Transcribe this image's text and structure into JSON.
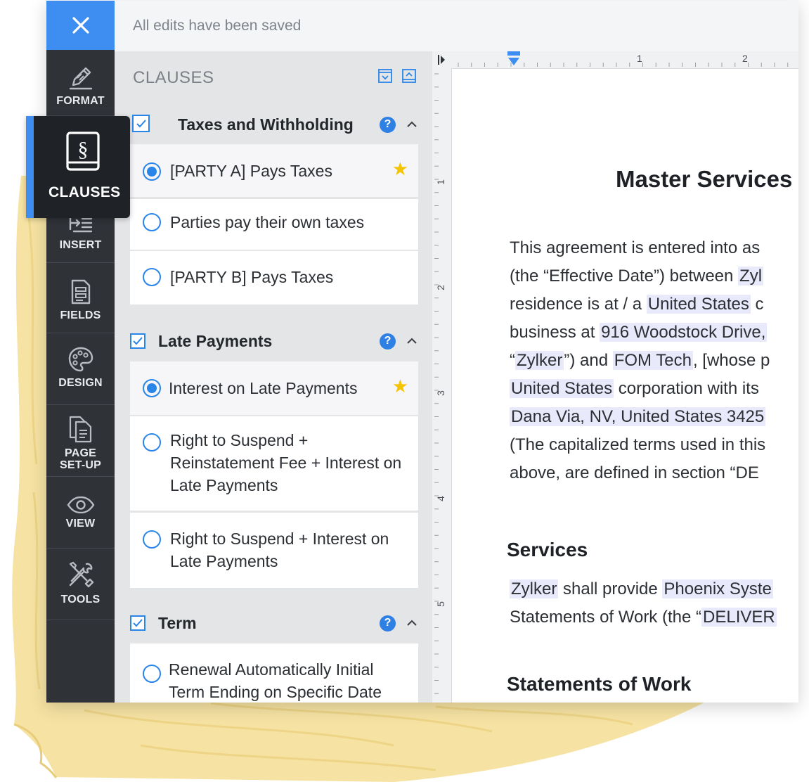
{
  "topbar": {
    "status": "All edits have been saved"
  },
  "icons": {
    "close": "close-icon"
  },
  "nav": [
    {
      "id": "format",
      "label": "FORMAT",
      "icon": "pen-icon"
    },
    {
      "id": "clauses",
      "label": "CLAUSES",
      "icon": "section-book-icon",
      "active": true
    },
    {
      "id": "insert",
      "label": "INSERT",
      "icon": "insert-icon"
    },
    {
      "id": "fields",
      "label": "FIELDS",
      "icon": "form-fields-icon"
    },
    {
      "id": "design",
      "label": "DESIGN",
      "icon": "palette-icon"
    },
    {
      "id": "page-setup",
      "label": "PAGE SET-UP",
      "icon": "pages-icon"
    },
    {
      "id": "view",
      "label": "VIEW",
      "icon": "eye-icon"
    },
    {
      "id": "tools",
      "label": "TOOLS",
      "icon": "wrench-screwdriver-icon"
    }
  ],
  "clauses": {
    "title": "CLAUSES",
    "groups": [
      {
        "title": "Taxes and Withholding",
        "checked": true,
        "options": [
          {
            "text": "[PARTY A] Pays Taxes",
            "selected": true,
            "starred": true
          },
          {
            "text": "Parties pay their own taxes",
            "selected": false
          },
          {
            "text": "[PARTY B] Pays Taxes",
            "selected": false
          }
        ]
      },
      {
        "title": "Late Payments",
        "checked": true,
        "options": [
          {
            "text": "Interest on Late Payments",
            "selected": true,
            "starred": true
          },
          {
            "text": "Right to Suspend + Reinstatement Fee + Interest on Late Payments",
            "selected": false
          },
          {
            "text": "Right to Suspend + Interest on Late Payments",
            "selected": false
          }
        ]
      },
      {
        "title": "Term",
        "checked": true,
        "options": [
          {
            "text": "Renewal Automatically Initial Term Ending on Specific Date",
            "selected": false
          }
        ]
      }
    ]
  },
  "ruler": {
    "top": [
      "1",
      "2"
    ],
    "left": [
      "1",
      "2",
      "3",
      "4",
      "5"
    ]
  },
  "document": {
    "title": "Master Services",
    "intro": [
      [
        "This agreement is entered into as"
      ],
      [
        "(the “Effective Date”) between ",
        {
          "hl": "Zyl"
        }
      ],
      [
        "residence is at / a ",
        {
          "hl": "United States"
        },
        " c"
      ],
      [
        "business at ",
        {
          "hl": "916 Woodstock Drive,"
        }
      ],
      [
        "“",
        {
          "hl": "Zylker"
        },
        "”) and ",
        {
          "hl": "FOM Tech"
        },
        ", [whose p"
      ],
      [
        {
          "hl": "United States"
        },
        " corporation with its"
      ],
      [
        {
          "hl": "Dana Via, NV, United States 3425"
        }
      ],
      [
        "(The capitalized terms used in this"
      ],
      [
        "above, are defined in section “DE"
      ]
    ],
    "services_heading": "Services",
    "services": [
      [
        {
          "hl": "Zylker"
        },
        " shall provide ",
        {
          "hl": "Phoenix Syste"
        }
      ],
      [
        "Statements of Work (the “",
        {
          "hl": "DELIVER"
        }
      ]
    ],
    "sow_heading": "Statements of Work"
  },
  "colors": {
    "accent": "#3d8ef0",
    "sidebar": "#2f3338",
    "active_nav": "#1f2226",
    "highlight": "#e8e9fb",
    "star": "#f5c400"
  }
}
